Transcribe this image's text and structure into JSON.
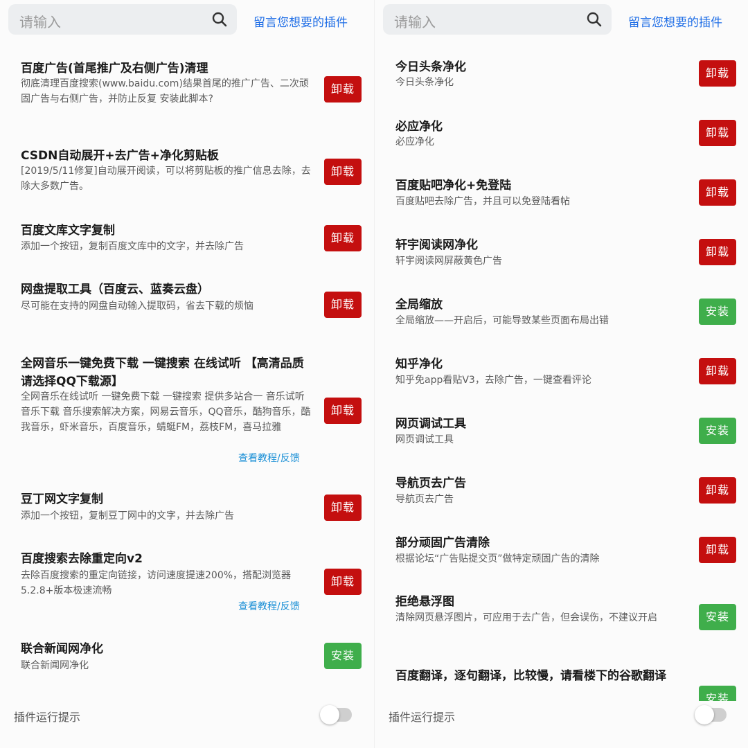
{
  "left": {
    "search_placeholder": "请输入",
    "request_plugin_link": "留言您想要的插件",
    "footer_label": "插件运行提示",
    "items": [
      {
        "title": "百度广告(首尾推广及右侧广告)清理",
        "desc": "彻底清理百度搜索(www.baidu.com)结果首尾的推广广告、二次顽固广告与右侧广告，并防止反复 安装此脚本?",
        "button": "卸载",
        "state": "uninstall"
      },
      {
        "title": "CSDN自动展开+去广告+净化剪贴板",
        "desc": "[2019/5/11修复]自动展开阅读，可以将剪贴板的推广信息去除，去除大多数广告。",
        "button": "卸载",
        "state": "uninstall"
      },
      {
        "title": "百度文库文字复制",
        "desc": "添加一个按钮，复制百度文库中的文字，并去除广告",
        "button": "卸载",
        "state": "uninstall"
      },
      {
        "title": "网盘提取工具（百度云、蓝奏云盘）",
        "desc": "尽可能在支持的网盘自动输入提取码，省去下载的烦恼",
        "button": "卸载",
        "state": "uninstall"
      },
      {
        "title": "全网音乐一键免费下载 一键搜索 在线试听 【高清品质请选择QQ下载源】",
        "desc": "全网音乐在线试听 一键免费下载 一键搜索 提供多站合一 音乐试听 音乐下载 音乐搜索解决方案，网易云音乐，QQ音乐，酷狗音乐，酷我音乐，虾米音乐，百度音乐，蜻蜓FM，荔枝FM，喜马拉雅",
        "button": "卸载",
        "state": "uninstall",
        "link": "查看教程/反馈"
      },
      {
        "title": "豆丁网文字复制",
        "desc": "添加一个按钮，复制豆丁网中的文字，并去除广告",
        "button": "卸载",
        "state": "uninstall"
      },
      {
        "title": "百度搜索去除重定向v2",
        "desc": "去除百度搜索的重定向链接，访问速度提速200%，搭配浏览器5.2.8+版本极速流畅",
        "button": "卸载",
        "state": "uninstall",
        "link": "查看教程/反馈"
      },
      {
        "title": "联合新闻网净化",
        "desc": "联合新闻网净化",
        "button": "安装",
        "state": "install"
      }
    ]
  },
  "right": {
    "search_placeholder": "请输入",
    "request_plugin_link": "留言您想要的插件",
    "footer_label": "插件运行提示",
    "items": [
      {
        "title": "今日头条净化",
        "desc": "今日头条净化",
        "button": "卸载",
        "state": "uninstall"
      },
      {
        "title": "必应净化",
        "desc": "必应净化",
        "button": "卸载",
        "state": "uninstall"
      },
      {
        "title": "百度贴吧净化+免登陆",
        "desc": "百度贴吧去除广告，并且可以免登陆看帖",
        "button": "卸载",
        "state": "uninstall"
      },
      {
        "title": "轩宇阅读网净化",
        "desc": "轩宇阅读网屏蔽黄色广告",
        "button": "卸载",
        "state": "uninstall"
      },
      {
        "title": "全局缩放",
        "desc": "全局缩放——开启后，可能导致某些页面布局出错",
        "button": "安装",
        "state": "install"
      },
      {
        "title": "知乎净化",
        "desc": "知乎免app看贴V3，去除广告，一键查看评论",
        "button": "卸载",
        "state": "uninstall"
      },
      {
        "title": "网页调试工具",
        "desc": "网页调试工具",
        "button": "安装",
        "state": "install"
      },
      {
        "title": "导航页去广告",
        "desc": "导航页去广告",
        "button": "卸载",
        "state": "uninstall"
      },
      {
        "title": "部分顽固广告清除",
        "desc": "根据论坛“广告贴提交页”做特定顽固广告的清除",
        "button": "卸载",
        "state": "uninstall"
      },
      {
        "title": "拒绝悬浮图",
        "desc": "清除网页悬浮图片，可应用于去广告，但会误伤，不建议开启",
        "button": "安装",
        "state": "install"
      },
      {
        "title": "百度翻译，逐句翻译，比较慢，请看楼下的谷歌翻译",
        "desc": "",
        "button": "安装",
        "state": "install"
      }
    ]
  },
  "colors": {
    "uninstall_button": "#c40f0f",
    "install_button": "#3fae4b",
    "link_blue": "#1e6de6",
    "search_bg": "#eceef0"
  },
  "icons": {
    "search": "search-icon"
  }
}
